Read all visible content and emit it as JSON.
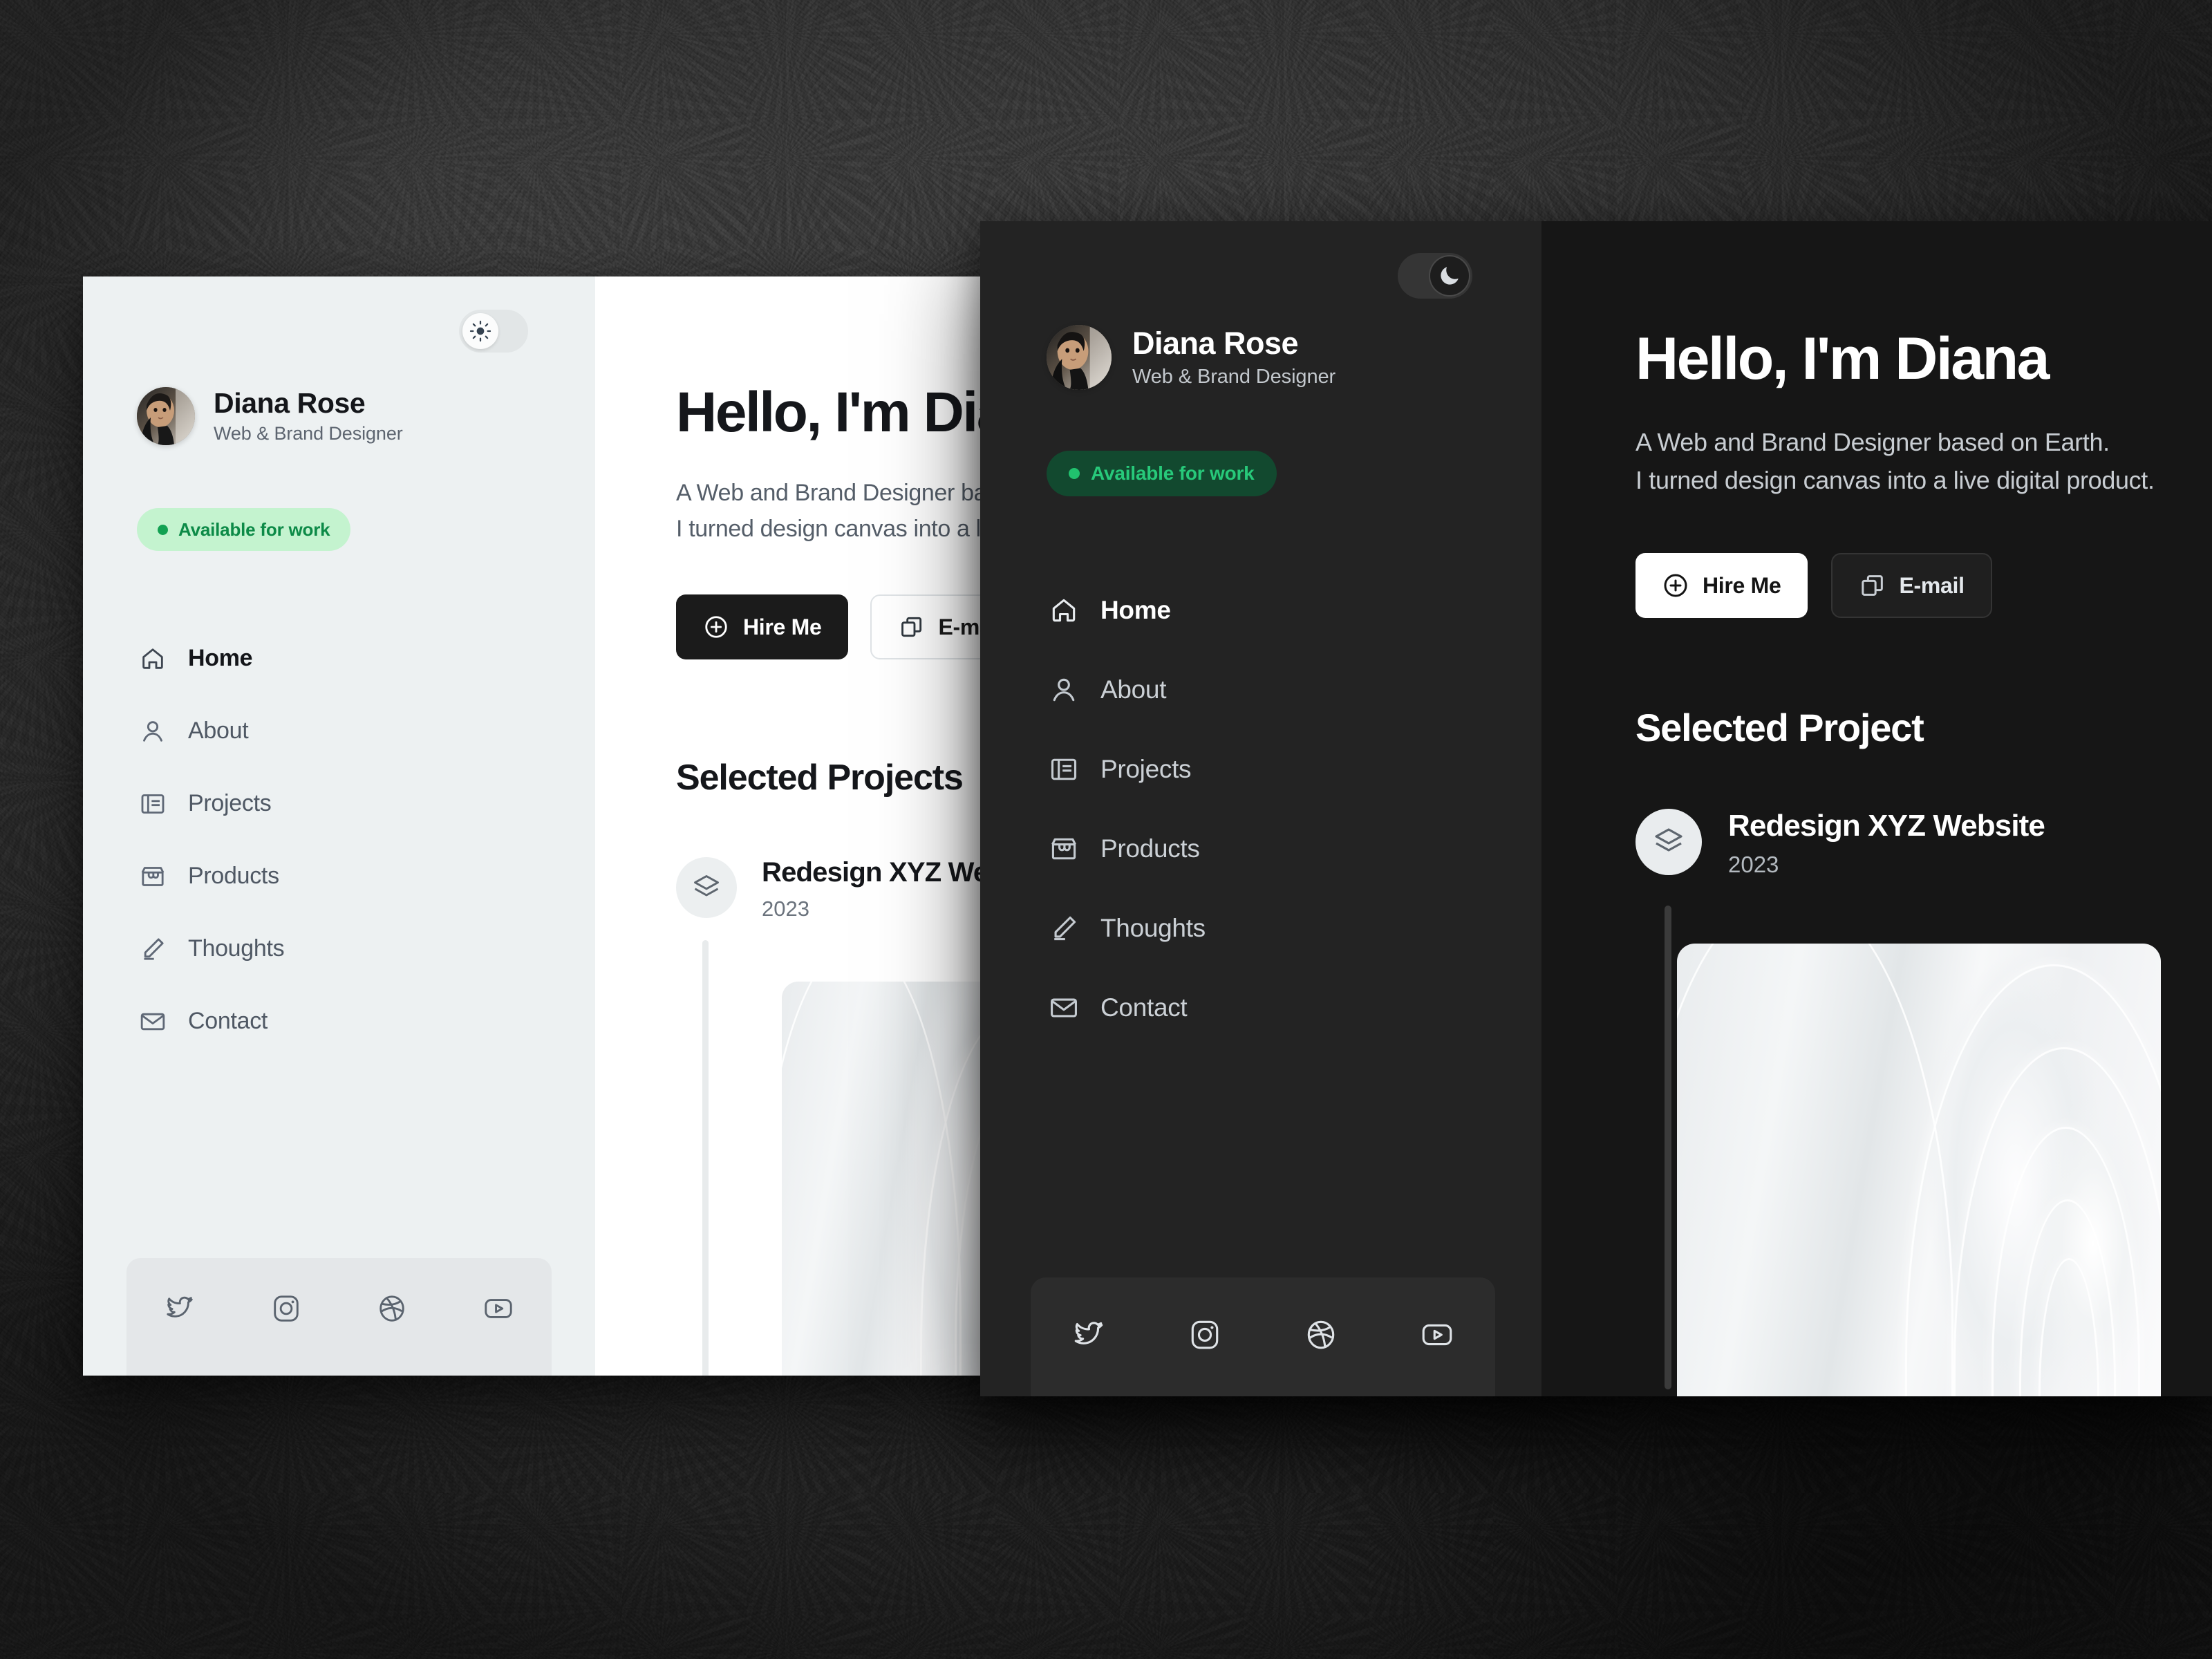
{
  "profile": {
    "name": "Diana Rose",
    "role": "Web & Brand Designer",
    "availability": "Available for work"
  },
  "nav": {
    "items": [
      {
        "label": "Home",
        "icon": "home-icon",
        "active": true
      },
      {
        "label": "About",
        "icon": "user-icon",
        "active": false
      },
      {
        "label": "Projects",
        "icon": "book-icon",
        "active": false
      },
      {
        "label": "Products",
        "icon": "store-icon",
        "active": false
      },
      {
        "label": "Thoughts",
        "icon": "pencil-icon",
        "active": false
      },
      {
        "label": "Contact",
        "icon": "envelope-icon",
        "active": false
      }
    ]
  },
  "social": {
    "items": [
      {
        "name": "twitter-icon"
      },
      {
        "name": "instagram-icon"
      },
      {
        "name": "dribbble-icon"
      },
      {
        "name": "youtube-icon"
      }
    ]
  },
  "hero": {
    "heading_light": "Hello, I'm Diana",
    "heading_dark": "Hello, I'm Diana",
    "paragraph_line1": "A Web and Brand Designer based on Earth.",
    "paragraph_line2": "I turned design canvas into a live digital product.",
    "buttons": {
      "primary": "Hire Me",
      "secondary": "E-mail"
    }
  },
  "projects": {
    "heading_light": "Selected Projects",
    "heading_dark": "Selected Project",
    "items": [
      {
        "title": "Redesign XYZ Website",
        "year": "2023",
        "icon": "layers-icon"
      }
    ]
  },
  "theme_toggle": {
    "light_icon": "sun-icon",
    "dark_icon": "moon-icon",
    "light_state": "light",
    "dark_state": "dark"
  },
  "colors": {
    "accent_green_light": "#0c8a47",
    "accent_green_dark": "#27c97a",
    "badge_bg_light": "#c4f3cf",
    "badge_bg_dark": "#12492f",
    "sidebar_light": "#edf1f2",
    "sidebar_dark": "#232323",
    "main_light": "#ffffff",
    "main_dark": "#161616"
  }
}
